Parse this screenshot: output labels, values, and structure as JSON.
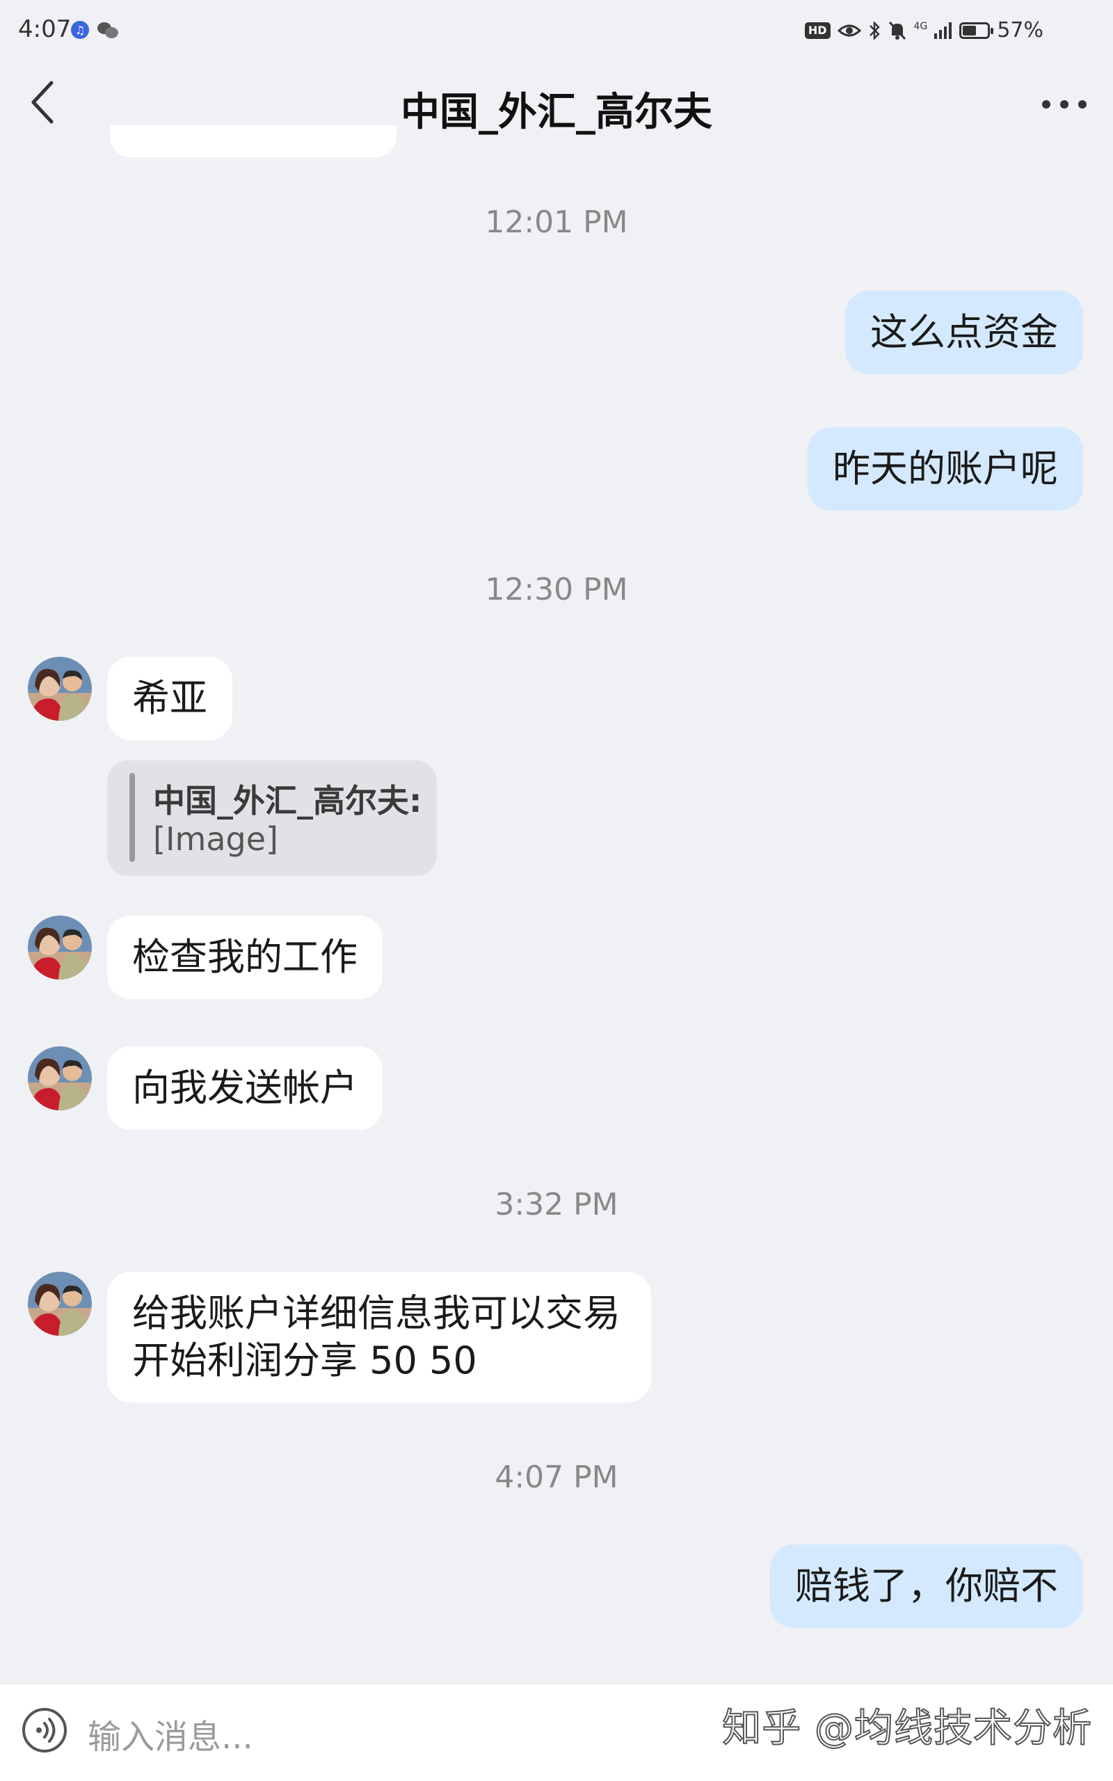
{
  "status_bar": {
    "time": "4:07",
    "hd_label": "HD",
    "network": "4G",
    "battery_percent": "57%",
    "battery_level": 0.57
  },
  "header": {
    "title": "中国_外汇_高尔夫"
  },
  "messages": {
    "ts1": "12:01 PM",
    "out1": "这么点资金",
    "out2": "昨天的账户呢",
    "ts2": "12:30 PM",
    "in1": "希亚",
    "quote_sender": "中国_外汇_高尔夫:",
    "quote_text": "[Image]",
    "in2": "检查我的工作",
    "in3": "向我发送帐户",
    "ts3": "3:32 PM",
    "in4": "给我账户详细信息我可以交易开始利润分享 50 50",
    "ts4": "4:07 PM",
    "out3": "赔钱了，你赔不"
  },
  "input": {
    "placeholder": "输入消息..."
  },
  "watermark": "知乎 @均线技术分析",
  "colors": {
    "background": "#f0f1f5",
    "outgoing_bubble": "#d4e9fd",
    "incoming_bubble": "#ffffff"
  }
}
